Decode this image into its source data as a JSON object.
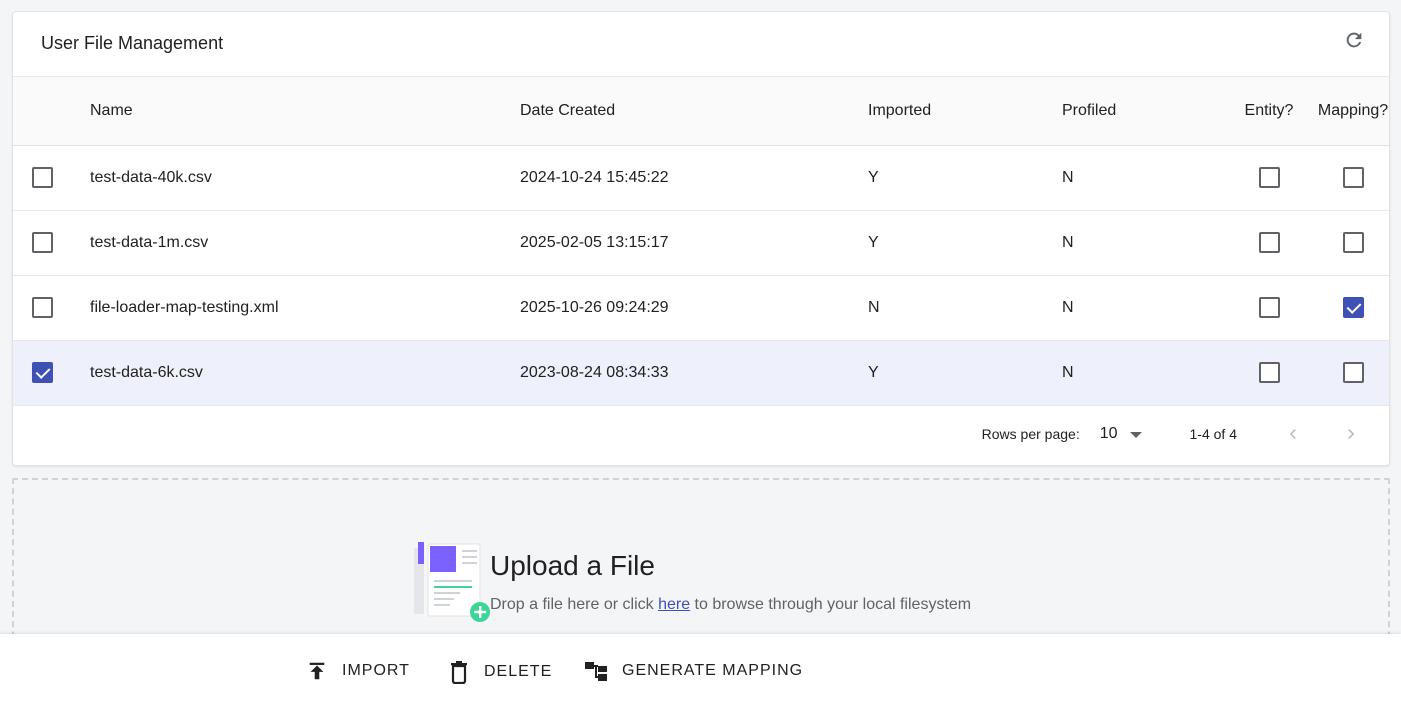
{
  "card": {
    "title": "User File Management",
    "refresh_icon": "refresh-icon"
  },
  "table": {
    "headers": {
      "name": "Name",
      "date_created": "Date Created",
      "imported": "Imported",
      "profiled": "Profiled",
      "entity": "Entity?",
      "mapping": "Mapping?"
    },
    "rows": [
      {
        "selected": false,
        "name": "test-data-40k.csv",
        "date_created": "2024-10-24 15:45:22",
        "imported": "Y",
        "profiled": "N",
        "entity": false,
        "mapping": false
      },
      {
        "selected": false,
        "name": "test-data-1m.csv",
        "date_created": "2025-02-05 13:15:17",
        "imported": "Y",
        "profiled": "N",
        "entity": false,
        "mapping": false
      },
      {
        "selected": false,
        "name": "file-loader-map-testing.xml",
        "date_created": "2025-10-26 09:24:29",
        "imported": "N",
        "profiled": "N",
        "entity": false,
        "mapping": true
      },
      {
        "selected": true,
        "name": "test-data-6k.csv",
        "date_created": "2023-08-24 08:34:33",
        "imported": "Y",
        "profiled": "N",
        "entity": false,
        "mapping": false
      }
    ]
  },
  "pagination": {
    "rows_per_page_label": "Rows per page:",
    "rows_per_page_value": "10",
    "range": "1-4 of 4"
  },
  "upload": {
    "title": "Upload a File",
    "sub_before": "Drop a file here or click ",
    "link_text": "here",
    "sub_after": " to browse through your local filesystem"
  },
  "toolbar": {
    "import_label": "IMPORT",
    "delete_label": "DELETE",
    "generate_mapping_label": "GENERATE MAPPING"
  },
  "colors": {
    "accent": "#3f51b5",
    "selected_row": "#eef1fb",
    "upload_purple": "#7b61ff",
    "upload_green": "#3dd598"
  }
}
